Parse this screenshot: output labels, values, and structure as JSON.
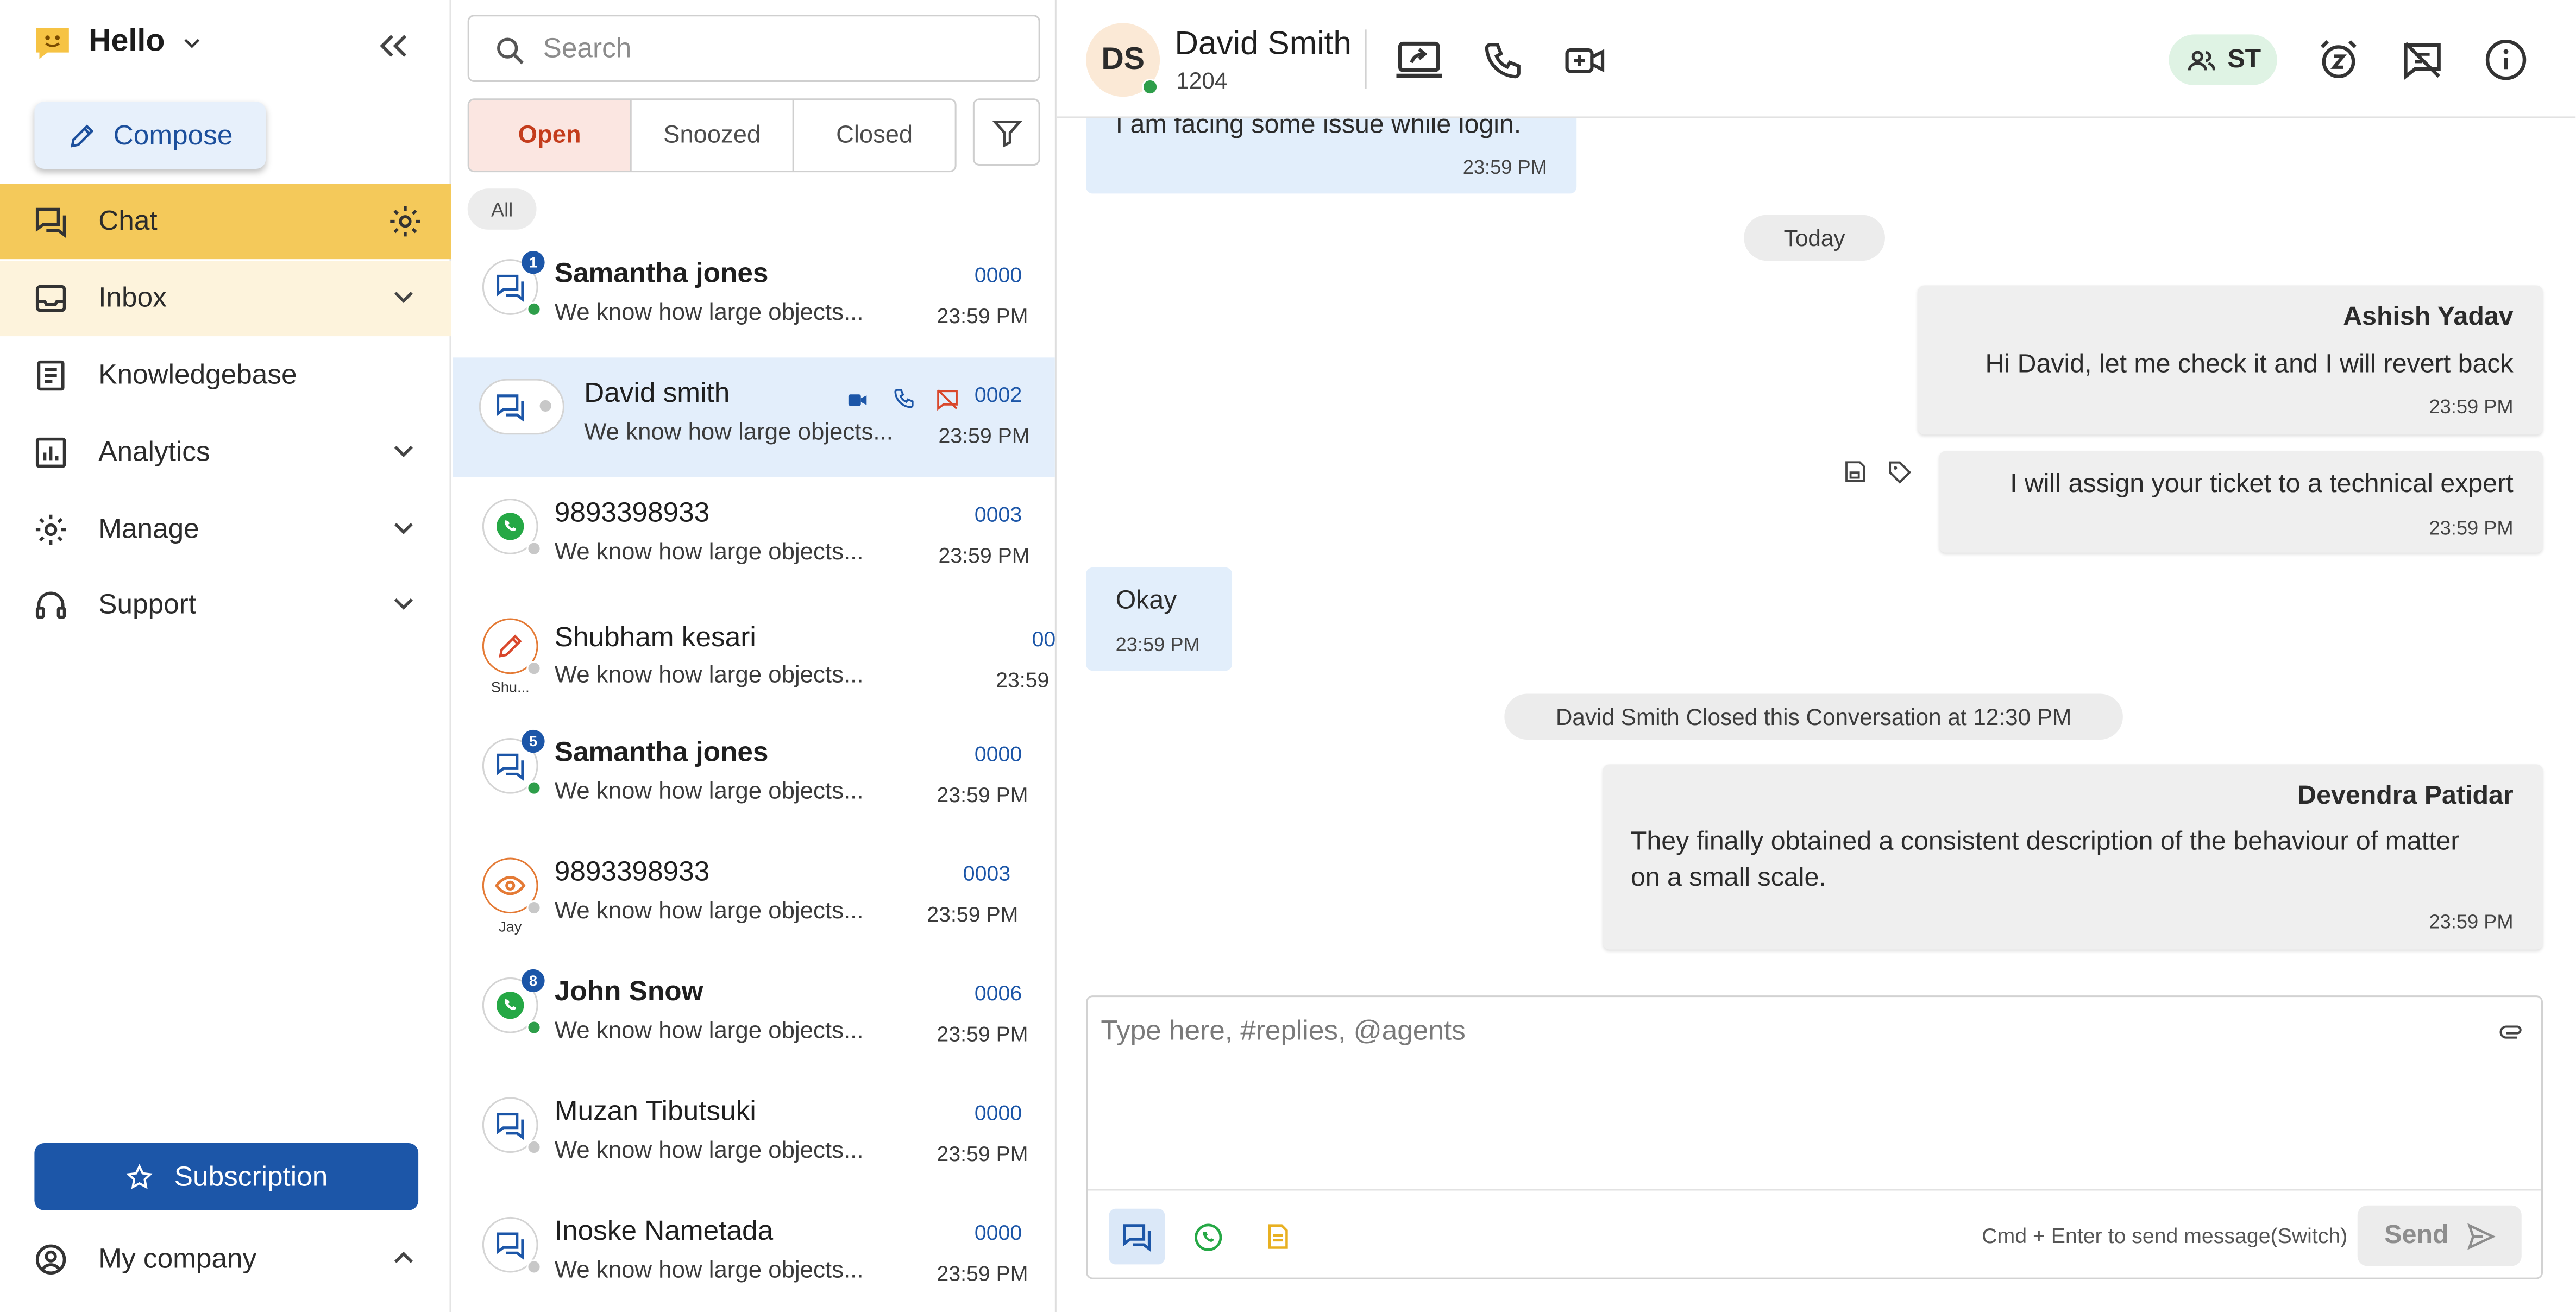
{
  "sidebar": {
    "brand": "Hello",
    "compose_label": "Compose",
    "nav": [
      {
        "label": "Chat",
        "icon": "chat-icon",
        "right": "gear-icon",
        "state": "active"
      },
      {
        "label": "Inbox",
        "icon": "inbox-icon",
        "right": "chevron-down-icon",
        "state": "highlight"
      },
      {
        "label": "Knowledgebase",
        "icon": "document-icon",
        "right": "",
        "state": ""
      },
      {
        "label": "Analytics",
        "icon": "analytics-icon",
        "right": "chevron-down-icon",
        "state": ""
      },
      {
        "label": "Manage",
        "icon": "gear-icon",
        "right": "chevron-down-icon",
        "state": ""
      },
      {
        "label": "Support",
        "icon": "headset-icon",
        "right": "chevron-down-icon",
        "state": ""
      }
    ],
    "subscription_label": "Subscription",
    "company_label": "My company"
  },
  "list": {
    "search_placeholder": "Search",
    "tabs": [
      "Open",
      "Snoozed",
      "Closed"
    ],
    "active_tab": "Open",
    "chip": "All",
    "conversations": [
      {
        "name": "Samantha jones",
        "preview": "We know how large objects...",
        "id": "0000",
        "time": "23:59 PM",
        "bold": true,
        "badge": "1",
        "channel": "chat",
        "status": "online",
        "caption": ""
      },
      {
        "name": "David smith",
        "preview": "We know how large objects...",
        "id": "0002",
        "time": "23:59 PM",
        "bold": false,
        "badge": "",
        "channel": "chat",
        "status": "offline",
        "caption": "",
        "selected": true
      },
      {
        "name": "9893398933",
        "preview": "We know how large objects...",
        "id": "0003",
        "time": "23:59 PM",
        "bold": false,
        "badge": "",
        "channel": "whatsapp",
        "status": "offline",
        "caption": ""
      },
      {
        "name": "Shubham kesari",
        "preview": "We know how large objects...",
        "id": "00",
        "time": "23:59",
        "bold": false,
        "badge": "",
        "channel": "edit",
        "status": "offline",
        "caption": "Shu..."
      },
      {
        "name": "Samantha jones",
        "preview": "We know how large objects...",
        "id": "0000",
        "time": "23:59 PM",
        "bold": true,
        "badge": "5",
        "channel": "chat",
        "status": "online",
        "caption": ""
      },
      {
        "name": "9893398933",
        "preview": "We know how large objects...",
        "id": "0003",
        "time": "23:59 PM",
        "bold": false,
        "badge": "",
        "channel": "eye",
        "status": "offline",
        "caption": "Jay"
      },
      {
        "name": "John Snow",
        "preview": "We know how large objects...",
        "id": "0006",
        "time": "23:59 PM",
        "bold": true,
        "badge": "8",
        "channel": "whatsapp",
        "status": "online",
        "caption": ""
      },
      {
        "name": "Muzan Tibutsuki",
        "preview": "We know how large objects...",
        "id": "0000",
        "time": "23:59 PM",
        "bold": false,
        "badge": "",
        "channel": "chat",
        "status": "offline",
        "caption": ""
      },
      {
        "name": "Inoske Nametada",
        "preview": "We know how large objects...",
        "id": "0000",
        "time": "23:59 PM",
        "bold": false,
        "badge": "",
        "channel": "chat",
        "status": "offline",
        "caption": ""
      }
    ]
  },
  "chat": {
    "contact_initials": "DS",
    "contact_name": "David Smith",
    "contact_number": "1204",
    "assignee_initials": "ST",
    "messages": {
      "m1_text": "I am facing some issue while login.",
      "m1_time": "23:59 PM",
      "divider": "Today",
      "m2_sender": "Ashish Yadav",
      "m2_text": "Hi David, let me check it and I will revert back",
      "m2_time": "23:59 PM",
      "m3_text": "I will assign your ticket to a technical expert",
      "m3_time": "23:59 PM",
      "m4_text": "Okay",
      "m4_time": "23:59 PM",
      "system": "David Smith Closed this Conversation at 12:30 PM",
      "m5_sender": "Devendra Patidar",
      "m5_text": "They finally obtained a consistent description of the behaviour of matter on a small scale.",
      "m5_time": "23:59 PM"
    },
    "composer": {
      "placeholder": "Type here, #replies, @agents",
      "hint": "Cmd + Enter to send message(Switch)",
      "send_label": "Send"
    }
  },
  "colors": {
    "brand_yellow": "#f4c95a",
    "primary_blue": "#1c56a8",
    "online_green": "#2e9e4a",
    "open_tab_red": "#c43c1c"
  }
}
